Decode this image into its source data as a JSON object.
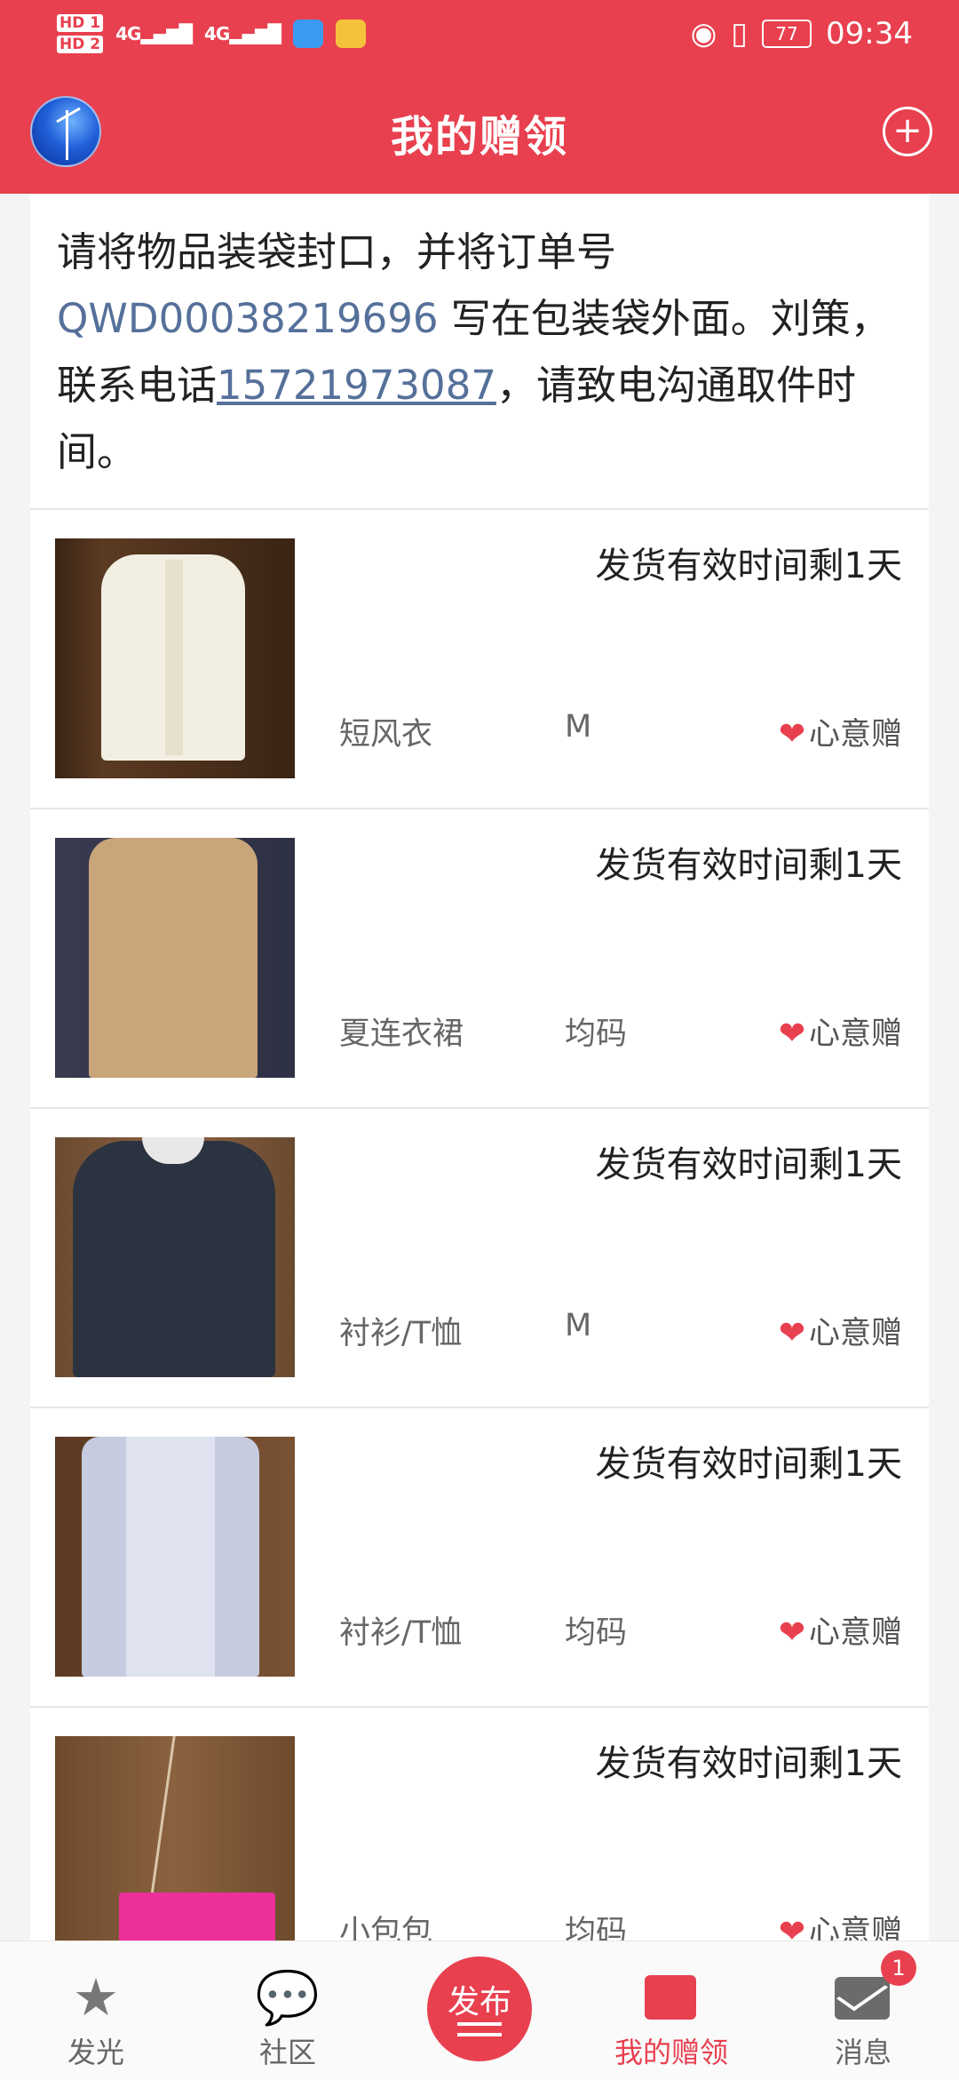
{
  "status_bar": {
    "hd1": "HD 1",
    "hd2": "HD 2",
    "signal1": "4G",
    "signal2": "4G",
    "battery": "77",
    "time": "09:34"
  },
  "header": {
    "title": "我的赠领"
  },
  "notice": {
    "text_before": "请将物品装袋封口，并将订单号 ",
    "order_code": "QWD00038219696",
    "text_middle": " 写在包装袋外面。刘策，联系电话",
    "phone": "15721973087",
    "text_after": "，请致电沟通取件时间。"
  },
  "items": [
    {
      "ship": "发货有效时间剩1天",
      "name": "短风衣",
      "size": "M",
      "tag": "心意赠"
    },
    {
      "ship": "发货有效时间剩1天",
      "name": "夏连衣裙",
      "size": "均码",
      "tag": "心意赠"
    },
    {
      "ship": "发货有效时间剩1天",
      "name": "衬衫/T恤",
      "size": "M",
      "tag": "心意赠"
    },
    {
      "ship": "发货有效时间剩1天",
      "name": "衬衫/T恤",
      "size": "均码",
      "tag": "心意赠"
    },
    {
      "ship": "发货有效时间剩1天",
      "name": "小包包",
      "size": "均码",
      "tag": "心意赠"
    }
  ],
  "bottom_nav": {
    "items": [
      {
        "label": "发光",
        "icon": "star-icon"
      },
      {
        "label": "社区",
        "icon": "chat-bubble-icon"
      },
      {
        "label": "发布",
        "icon": "publish-icon"
      },
      {
        "label": "我的赠领",
        "icon": "gift-box-icon",
        "active": true
      },
      {
        "label": "消息",
        "icon": "mail-icon",
        "badge": "1"
      }
    ]
  },
  "colors": {
    "brand": "#e8404f",
    "link": "#55709a"
  }
}
